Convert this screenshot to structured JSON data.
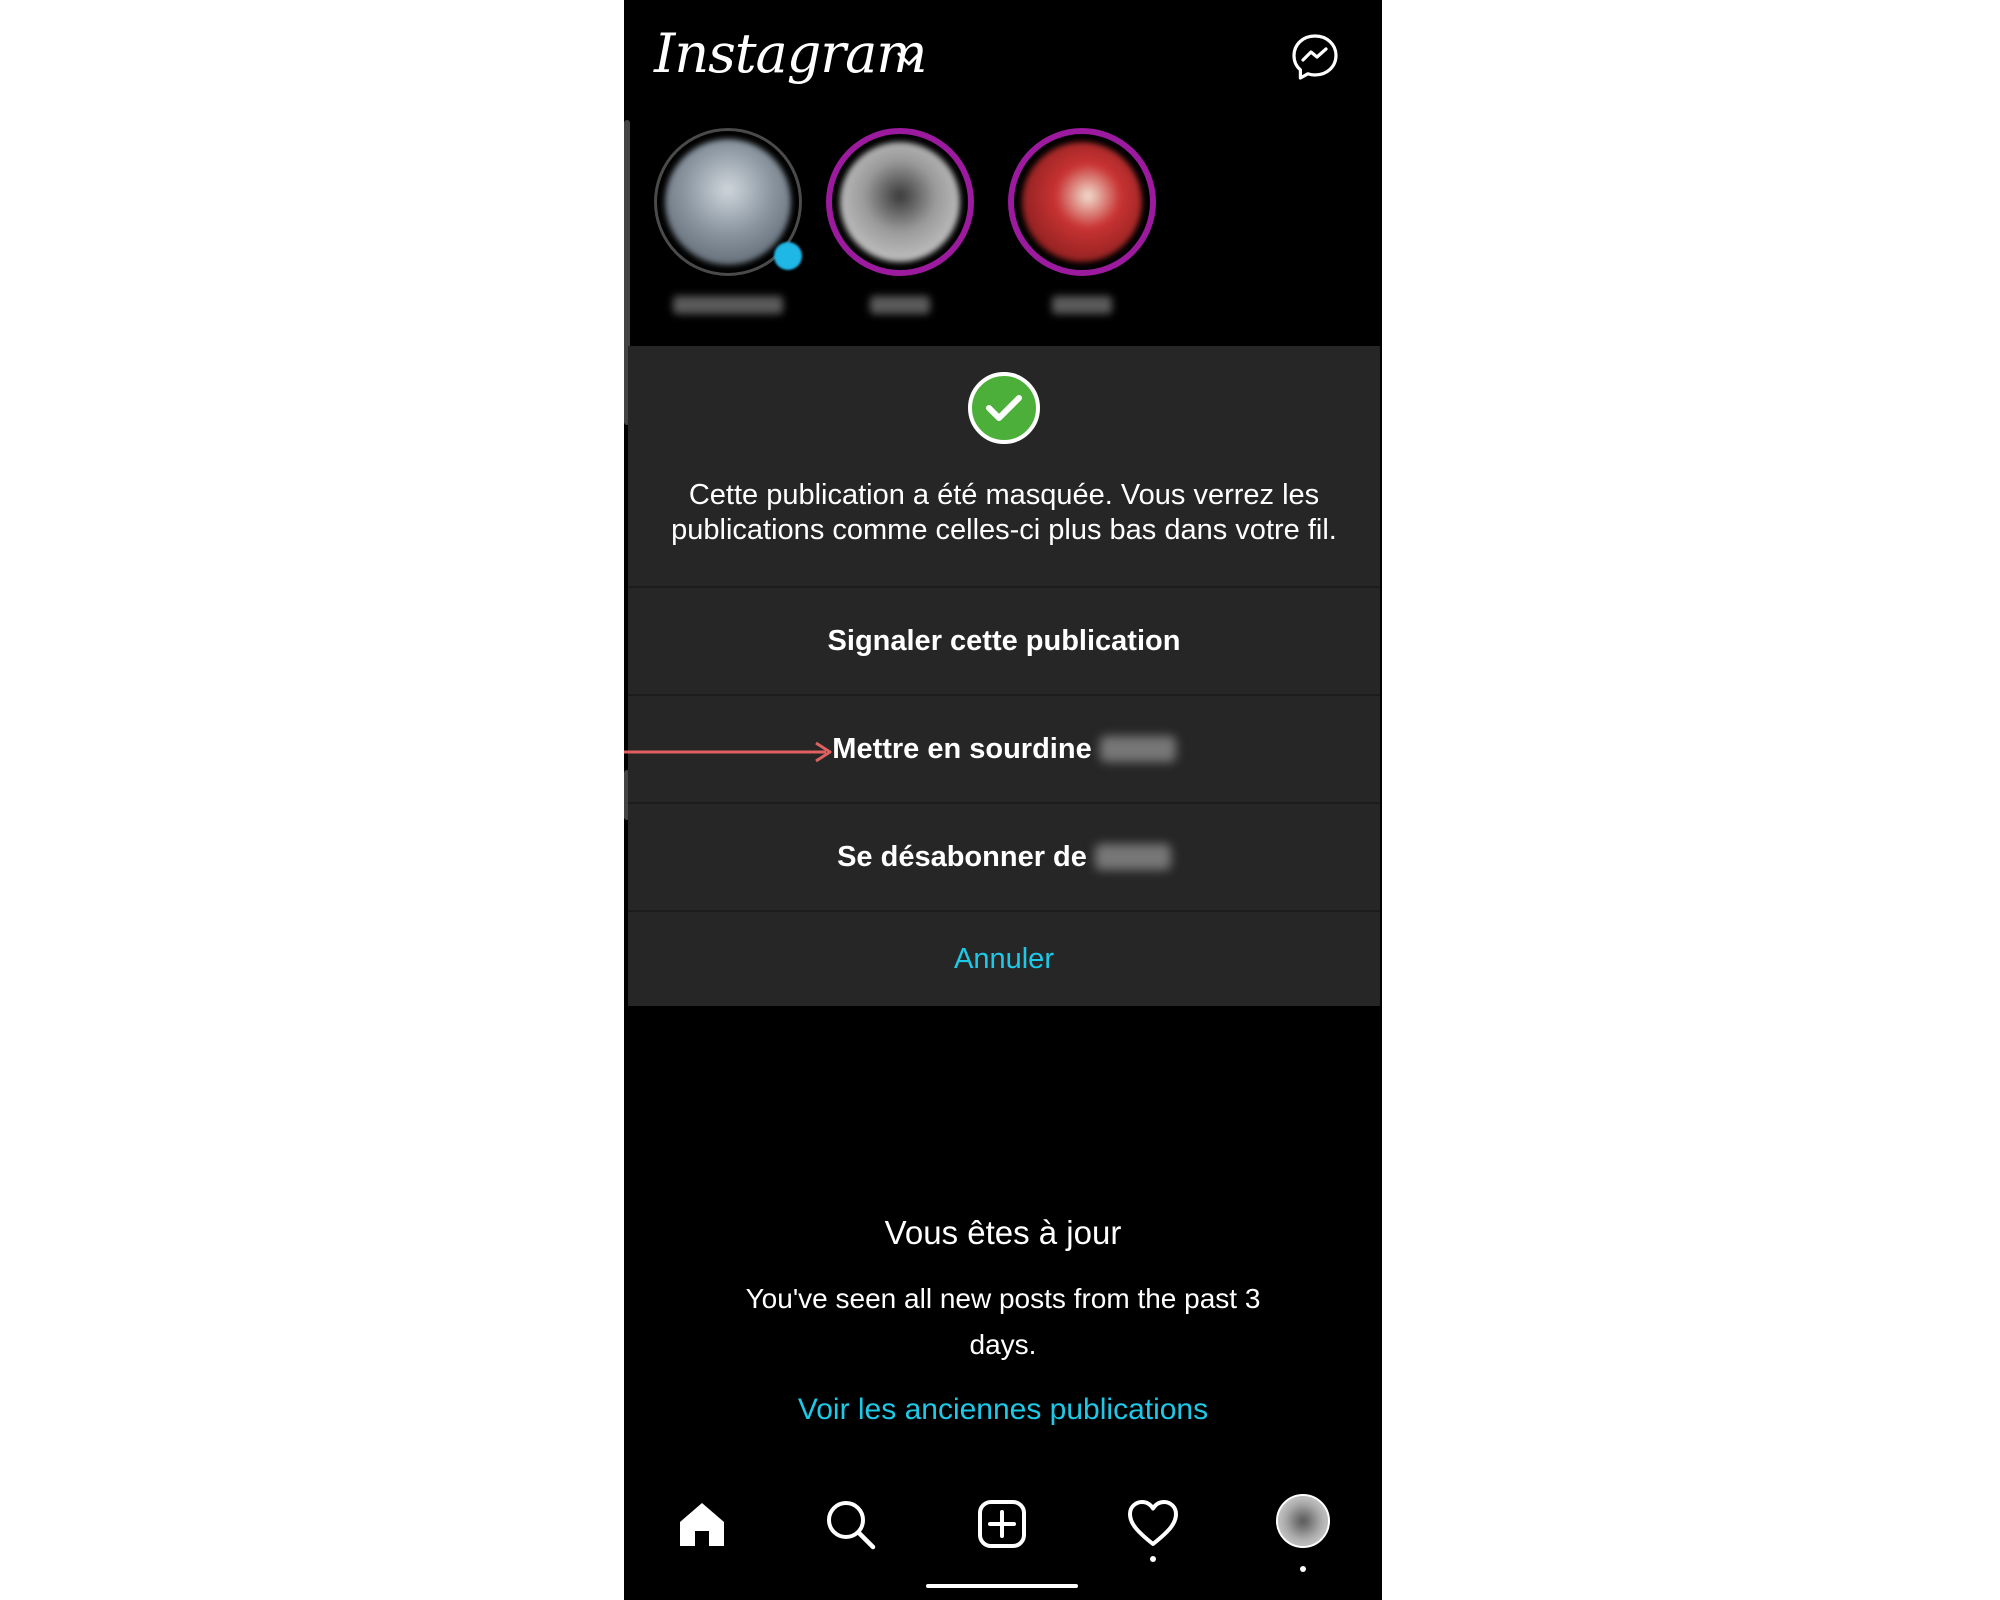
{
  "header": {
    "logo_text": "Instagram",
    "chevron_icon": "chevron-down-icon",
    "messenger_icon": "messenger-icon"
  },
  "stories": [
    {
      "label": "Votre story",
      "colors": [
        "#9aa4ae",
        "#5f6a75"
      ]
    },
    {
      "label": "story user",
      "colors": [
        "#c9c9c9",
        "#6f6f6f"
      ]
    },
    {
      "label": "story user",
      "colors": [
        "#c23a3a",
        "#6e1a1a"
      ]
    }
  ],
  "dialog": {
    "message": "Cette publication a été masquée. Vous verrez les publications comme celles-ci plus bas dans votre fil.",
    "report": "Signaler cette publication",
    "mute": "Mettre en sourdine",
    "unfollow": "Se désabonner de",
    "cancel": "Annuler"
  },
  "feed": {
    "caught_up_title": "Vous êtes à jour",
    "caught_up_subtitle": "You've seen all new posts from the past 3 days.",
    "older_posts_link": "Voir les anciennes publications"
  },
  "nav": {
    "items": [
      "home-icon",
      "search-icon",
      "new-post-icon",
      "activity-heart-icon",
      "profile-avatar"
    ]
  },
  "colors": {
    "accent": "#1ec9e8",
    "dialog_bg": "#262626",
    "success": "#4caf3a",
    "story_ring": "#9b1a9e",
    "annotation_arrow": "#e06060"
  }
}
